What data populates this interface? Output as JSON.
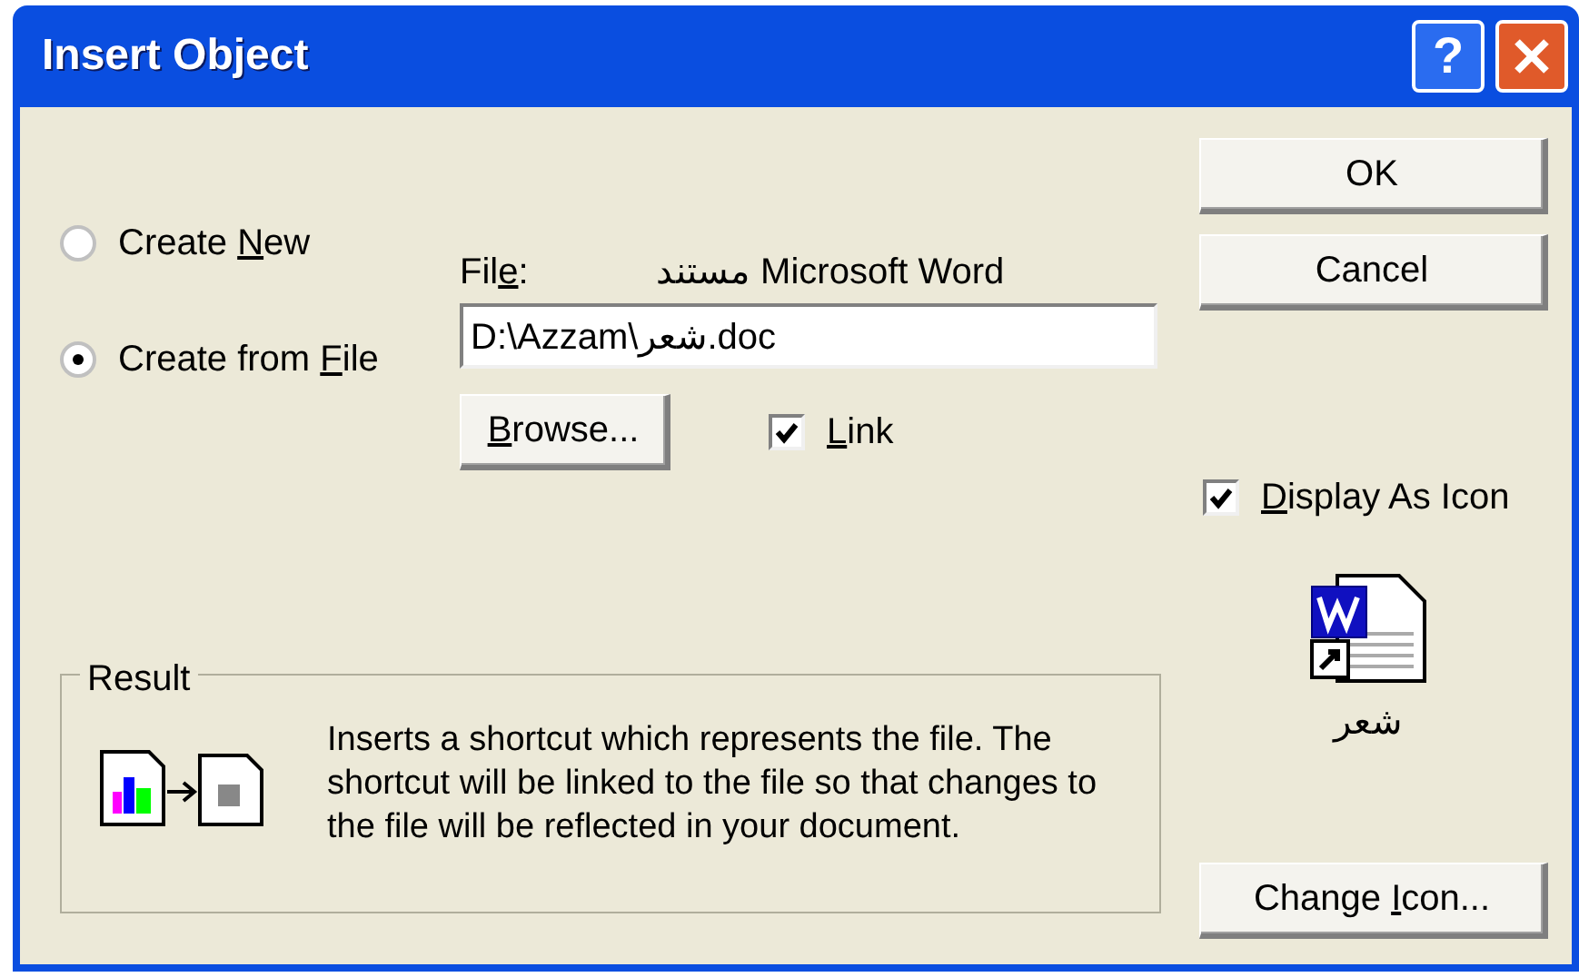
{
  "window": {
    "title": "Insert Object",
    "help_label": "?"
  },
  "options": [
    {
      "label": {
        "pre": "Create ",
        "key": "N",
        "post": "ew"
      },
      "selected": false
    },
    {
      "label": {
        "pre": "Create from ",
        "key": "F",
        "post": "ile"
      },
      "selected": true
    }
  ],
  "file": {
    "label": {
      "pre": "Fil",
      "key": "e",
      "post": ":"
    },
    "type_name": "مستند Microsoft Word",
    "value": "D:\\Azzam\\شعر.doc"
  },
  "browse": {
    "label": {
      "key": "B",
      "post": "rowse..."
    }
  },
  "link": {
    "label": {
      "key": "L",
      "post": "ink"
    },
    "checked": true
  },
  "buttons": [
    {
      "label": {
        "post": "OK"
      }
    },
    {
      "label": {
        "post": "Cancel"
      }
    }
  ],
  "display_as_icon": {
    "label": {
      "key": "D",
      "post": "isplay As Icon"
    },
    "checked": true
  },
  "icon_caption": "شعر",
  "result": {
    "title": "Result",
    "text": "Inserts a shortcut which represents the file.  The shortcut will be linked to the file so that changes to the file will be reflected in your document."
  },
  "change_icon": {
    "label": {
      "pre": "Change ",
      "key": "I",
      "post": "con..."
    }
  }
}
